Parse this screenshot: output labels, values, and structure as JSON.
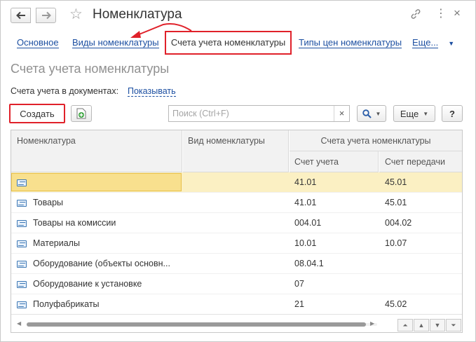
{
  "window": {
    "title": "Номенклатура",
    "back_icon": "arrow-left-icon",
    "forward_icon": "arrow-right-icon",
    "favorite_icon": "star-icon",
    "link_icon": "link-icon",
    "more_icon": "more-vertical-icon",
    "close_icon": "close-icon"
  },
  "tabs": [
    {
      "label": "Основное"
    },
    {
      "label": "Виды номенклатуры"
    },
    {
      "label": "Счета учета номенклатуры",
      "active": true
    },
    {
      "label": "Типы цен номенклатуры"
    },
    {
      "label": "Еще..."
    }
  ],
  "section_title": "Счета учета номенклатуры",
  "docs": {
    "label": "Счета учета в документах:",
    "link": "Показывать"
  },
  "toolbar": {
    "create_label": "Создать",
    "copy_icon": "copy-add-icon",
    "search_placeholder": "Поиск (Ctrl+F)",
    "search_clear": "×",
    "search_icon": "search-icon",
    "more_label": "Еще",
    "help_label": "?"
  },
  "table": {
    "headers": {
      "nomenclature": "Номенклатура",
      "kind": "Вид номенклатуры",
      "group": "Счета учета номенклатуры",
      "account": "Счет учета",
      "transfer": "Счет передачи"
    },
    "rows": [
      {
        "name": "",
        "kind": "",
        "account": "41.01",
        "transfer": "45.01",
        "selected": true
      },
      {
        "name": "Товары",
        "kind": "",
        "account": "41.01",
        "transfer": "45.01"
      },
      {
        "name": "Товары на комиссии",
        "kind": "",
        "account": "004.01",
        "transfer": "004.02"
      },
      {
        "name": "Материалы",
        "kind": "",
        "account": "10.01",
        "transfer": "10.07"
      },
      {
        "name": "Оборудование (объекты основн...",
        "kind": "",
        "account": "08.04.1",
        "transfer": ""
      },
      {
        "name": "Оборудование к установке",
        "kind": "",
        "account": "07",
        "transfer": ""
      },
      {
        "name": "Полуфабрикаты",
        "kind": "",
        "account": "21",
        "transfer": "45.02"
      }
    ]
  },
  "colors": {
    "accent_red": "#e0212a",
    "link_blue": "#1c4fa1",
    "selected_row": "#fbf0c3",
    "selected_border": "#e8c04a"
  }
}
